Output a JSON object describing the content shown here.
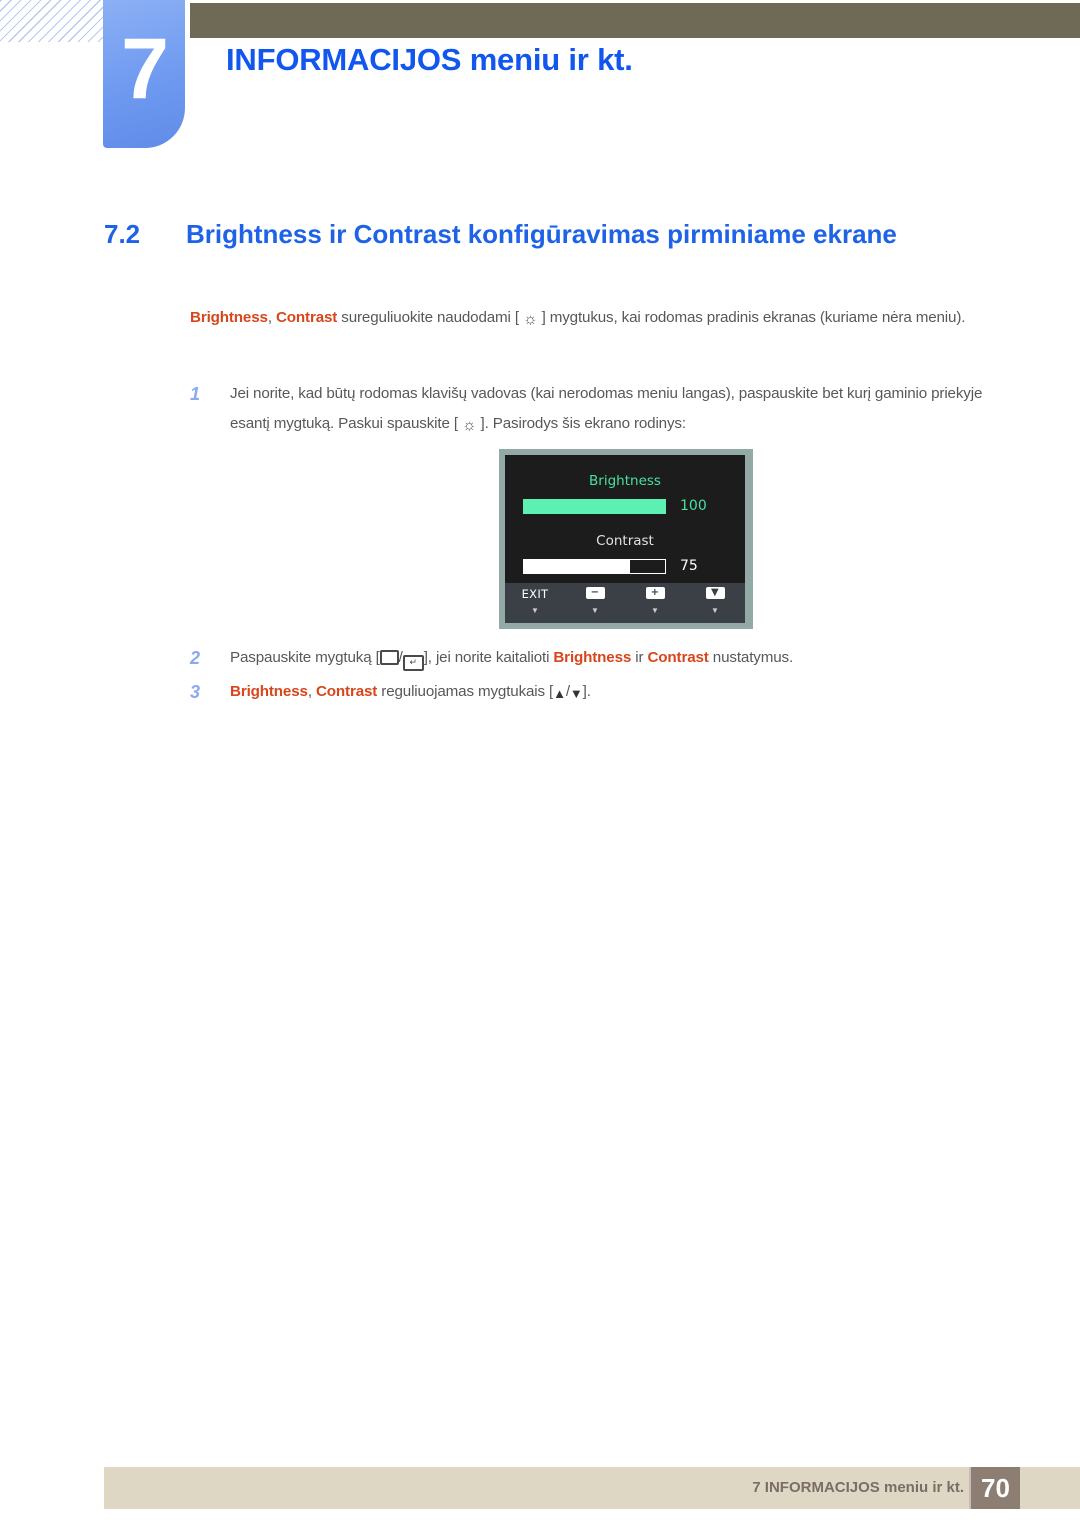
{
  "chapter": {
    "number": "7",
    "title": "INFORMACIJOS meniu ir kt."
  },
  "section": {
    "number": "7.2",
    "title": "Brightness ir Contrast konfigūravimas pirminiame ekrane"
  },
  "intro": {
    "kw1": "Brightness",
    "sep1": ", ",
    "kw2": "Contrast",
    "text_a": " sureguliuokite naudodami [ ",
    "icon": "brightness-sun-icon",
    "text_b": " ] mygtukus, kai rodomas pradinis ekranas (kuriame nėra meniu)."
  },
  "steps": [
    {
      "num": "1",
      "text_a": "Jei norite, kad būtų rodomas klavišų vadovas (kai nerodomas meniu langas), paspauskite bet kurį gaminio priekyje esantį mygtuką. Paskui spauskite [ ",
      "icon": "brightness-sun-icon",
      "text_b": " ]. Pasirodys šis ekrano rodinys:"
    },
    {
      "num": "2",
      "text_a": "Paspauskite mygtuką [",
      "glyph1": "menu-rect-icon",
      "slash": "/",
      "glyph2": "enter-rect-icon",
      "text_b": "], jei norite kaitalioti ",
      "kw1": "Brightness",
      "text_c": " ir ",
      "kw2": "Contrast",
      "text_d": " nustatymus."
    },
    {
      "num": "3",
      "kw1": "Brightness",
      "sep1": ", ",
      "kw2": "Contrast",
      "text_a": " reguliuojamas mygtukais [",
      "glyph1": "triangle-up-icon",
      "slash": "/",
      "glyph2": "triangle-down-icon",
      "text_b": "]."
    }
  ],
  "osd": {
    "brightness_label": "Brightness",
    "brightness_value": "100",
    "brightness_percent": 100,
    "contrast_label": "Contrast",
    "contrast_value": "75",
    "contrast_percent": 75,
    "keys": [
      {
        "label": "EXIT",
        "icon": "",
        "caret": "▼"
      },
      {
        "label": "",
        "icon": "−",
        "caret": "▼"
      },
      {
        "label": "",
        "icon": "+",
        "caret": "▼"
      },
      {
        "label": "",
        "icon": "▼",
        "caret": "▼"
      }
    ],
    "accent_color": "#5cf0b2"
  },
  "footer": {
    "text": "7 INFORMACIJOS meniu ir kt.",
    "page": "70"
  }
}
